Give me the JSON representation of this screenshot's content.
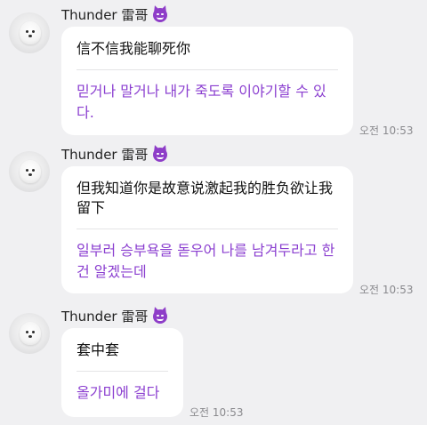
{
  "messages": [
    {
      "sender": "Thunder 雷哥",
      "avatar_icon": "white-dog-avatar",
      "badge_icon": "smiling-devil-emoji",
      "original": "信不信我能聊死你",
      "translation": "믿거나 말거나 내가 죽도록 이야기할 수 있다.",
      "time": "오전 10:53"
    },
    {
      "sender": "Thunder 雷哥",
      "avatar_icon": "white-dog-avatar",
      "badge_icon": "smiling-devil-emoji",
      "original": "但我知道你是故意说激起我的胜负欲让我留下",
      "translation": "일부러 승부욕을 돋우어 나를 남겨두라고 한 건 알겠는데",
      "time": "오전 10:53"
    },
    {
      "sender": "Thunder 雷哥",
      "avatar_icon": "white-dog-avatar",
      "badge_icon": "smiling-devil-emoji",
      "original": "套中套",
      "translation": "올가미에 걸다",
      "time": "오전 10:53"
    }
  ],
  "colors": {
    "background": "#f0f0f2",
    "bubble": "#ffffff",
    "translation_text": "#8b3fd0",
    "timestamp": "#8a8a8e",
    "badge": "#8e3dc8"
  }
}
